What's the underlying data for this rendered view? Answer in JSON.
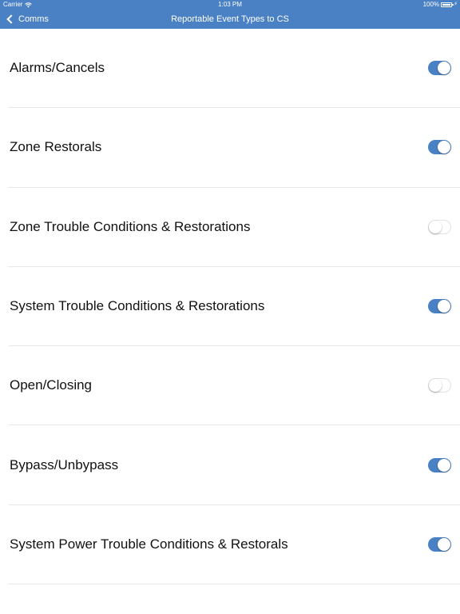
{
  "status_bar": {
    "carrier": "Carrier",
    "time": "1:03 PM",
    "battery": "100%"
  },
  "nav": {
    "back_label": "Comms",
    "title": "Reportable Event Types to CS"
  },
  "colors": {
    "accent": "#4a80c4",
    "background": "#ffffff",
    "separator": "#e6e6e6"
  },
  "settings": [
    {
      "label": "Alarms/Cancels",
      "enabled": true
    },
    {
      "label": "Zone Restorals",
      "enabled": true
    },
    {
      "label": "Zone Trouble Conditions & Restorations",
      "enabled": false
    },
    {
      "label": "System Trouble Conditions & Restorations",
      "enabled": true
    },
    {
      "label": "Open/Closing",
      "enabled": false
    },
    {
      "label": "Bypass/Unbypass",
      "enabled": true
    },
    {
      "label": "System Power Trouble Conditions & Restorals",
      "enabled": true
    }
  ]
}
